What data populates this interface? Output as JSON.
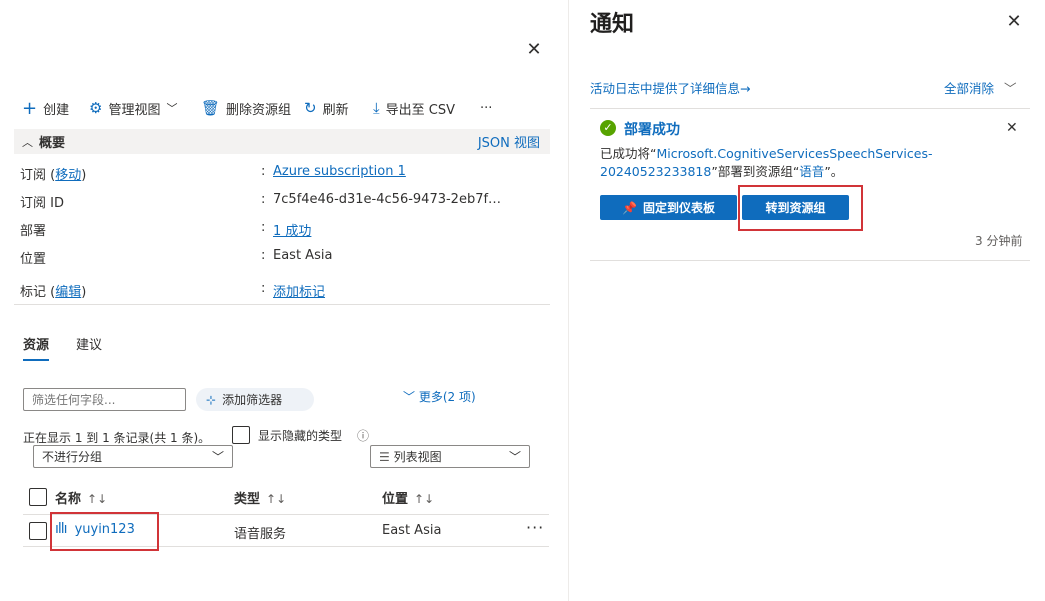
{
  "toolbar": {
    "create_label": "创建",
    "manage_view_label": "管理视图",
    "delete_group_label": "删除资源组",
    "refresh_label": "刷新",
    "export_label": "导出至 CSV",
    "more_label": "···"
  },
  "essentials": {
    "title": "概要",
    "json_view": "JSON 视图",
    "subscription_label_prefix": "订阅 (",
    "subscription_move_link": "移动",
    "subscription_label_suffix": ")",
    "subscription_value": "Azure subscription 1",
    "subscription_id_label": "订阅 ID",
    "subscription_id_value": "7c5f4e46-d31e-4c56-9473-2eb7f…",
    "deployments_label": "部署",
    "deployments_value": "1 成功",
    "location_label": "位置",
    "location_value": "East Asia",
    "tags_label_prefix": "标记 (",
    "tags_edit_link": "编辑",
    "tags_label_suffix": ")",
    "tags_value": "添加标记",
    "colon": ":"
  },
  "tabs": {
    "resources": "资源",
    "recommendations": "建议"
  },
  "filters": {
    "filter_placeholder": "筛选任何字段...",
    "add_filter": "添加筛选器",
    "more": "更多(2 项)",
    "records_text": "正在显示 1 到 1 条记录(共 1 条)。",
    "show_hidden_types": "显示隐藏的类型",
    "group_by": "不进行分组",
    "view_mode": "列表视图"
  },
  "table": {
    "columns": [
      "名称",
      "类型",
      "位置"
    ],
    "rows": [
      {
        "name": "yuyin123",
        "type": "语音服务",
        "location": "East Asia"
      }
    ]
  },
  "notifications": {
    "title": "通知",
    "activity_log_link": "活动日志中提供了详细信息→",
    "dismiss_all": "全部消除",
    "item": {
      "heading": "部署成功",
      "body_prefix": "已成功将“",
      "resource_name": "Microsoft.CognitiveServicesSpeechServices-20240523233818",
      "body_middle": "”部署到资源组“",
      "group_name": "语音",
      "body_suffix": "”。",
      "pin_button": "固定到仪表板",
      "goto_button": "转到资源组",
      "time": "3 分钟前"
    }
  },
  "colors": {
    "accent": "#0f6cbd",
    "success": "#57a300",
    "highlight": "#d13438"
  }
}
